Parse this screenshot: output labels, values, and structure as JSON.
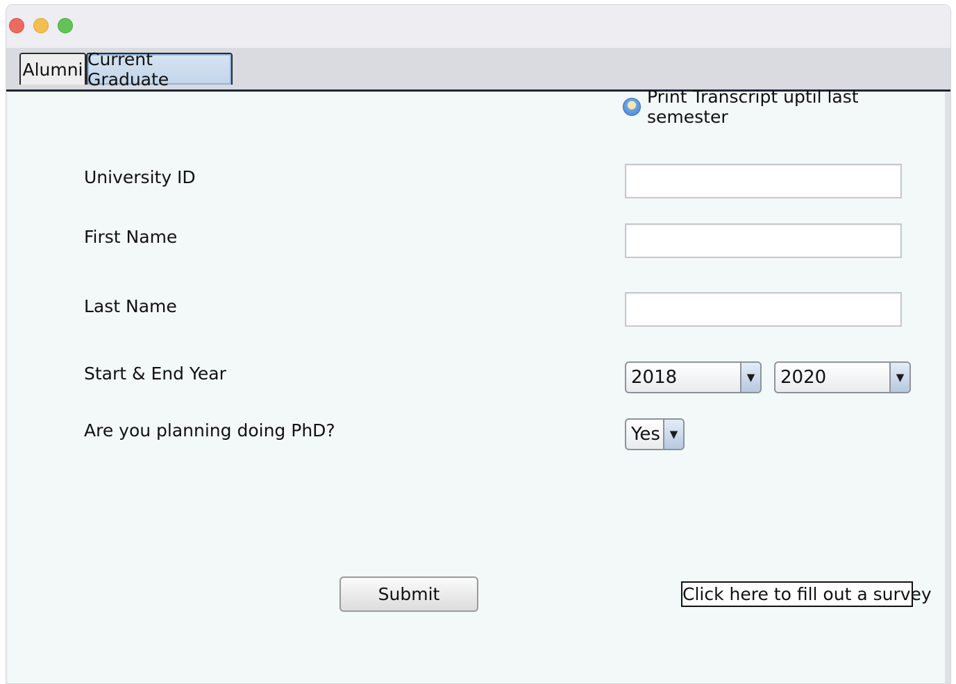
{
  "window": {
    "controls": [
      "close",
      "minimize",
      "maximize"
    ]
  },
  "tabs": {
    "items": [
      {
        "label": "Alumni",
        "selected": false
      },
      {
        "label": "Current Graduate",
        "selected": true
      }
    ]
  },
  "form": {
    "print_option_label": "Print Transcript uptil last semester",
    "university_id_label": "University ID",
    "university_id_value": "",
    "first_name_label": "First Name",
    "first_name_value": "",
    "last_name_label": "Last Name",
    "last_name_value": "",
    "years_label": "Start & End Year",
    "start_year": "2018",
    "end_year": "2020",
    "phd_label": "Are you planning doing PhD?",
    "phd_value": "Yes",
    "submit_label": "Submit",
    "survey_label": "Click here to fill out a survey"
  },
  "icons": {
    "radio": "radio-button-icon",
    "dropdown_arrow": "▼"
  },
  "colors": {
    "panel_bg": "#f3f8f9",
    "selected_tab": "#c2d5ea",
    "close": "#ed6a5e",
    "minimize": "#f5bf4f",
    "maximize": "#61c454"
  }
}
